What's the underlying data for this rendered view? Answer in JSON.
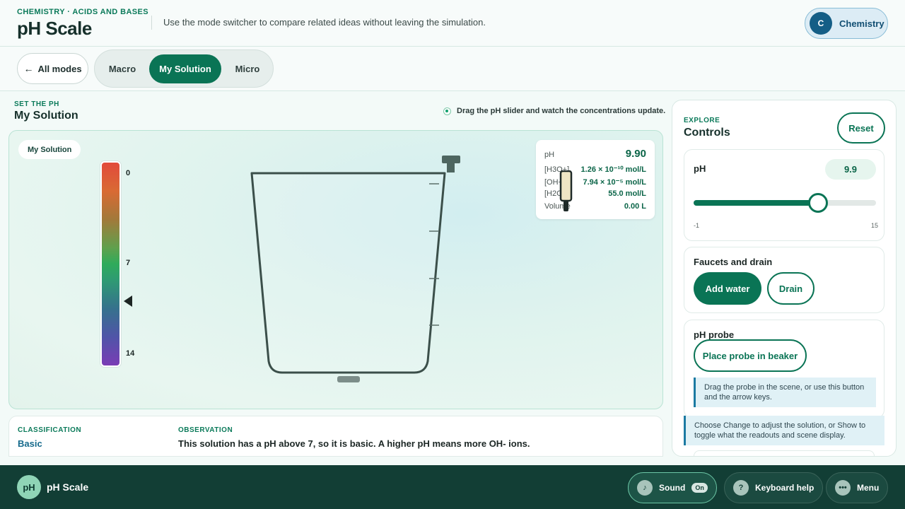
{
  "header": {
    "eyebrow": "CHEMISTRY · ACIDS AND BASES",
    "title": "pH Scale",
    "subtitle": "Use the mode switcher to compare related ideas without leaving the simulation.",
    "subject": {
      "initial": "C",
      "label": "Chemistry"
    }
  },
  "modebar": {
    "back_label": "All modes",
    "tabs": [
      {
        "label": "Macro",
        "active": false
      },
      {
        "label": "My Solution",
        "active": true
      },
      {
        "label": "Micro",
        "active": false
      }
    ]
  },
  "scene": {
    "eyebrow": "SET THE PH",
    "title": "My Solution",
    "hint": "Drag the pH slider and watch the concentrations update.",
    "tag": "My Solution",
    "scale_ticks": [
      "0",
      "7",
      "14"
    ],
    "readout": {
      "ph_label": "pH",
      "ph_value": "9.90",
      "rows": [
        {
          "label": "[H3O+]",
          "value": "1.26 × 10⁻¹⁰ mol/L"
        },
        {
          "label": "[OH−]",
          "value": "7.94 × 10⁻⁵ mol/L"
        },
        {
          "label": "[H2O]",
          "value": "55.0 mol/L"
        },
        {
          "label": "Volume",
          "value": "0.00 L"
        }
      ]
    }
  },
  "classification": {
    "label": "CLASSIFICATION",
    "value": "Basic",
    "observation_label": "OBSERVATION",
    "observation": "This solution has a pH above 7, so it is basic. A higher pH means more OH- ions."
  },
  "controls": {
    "eyebrow": "EXPLORE",
    "title": "Controls",
    "reset_label": "Reset",
    "ph": {
      "label": "pH",
      "value": 9.9,
      "display": "9.9",
      "min": -1,
      "max": 15,
      "min_label": "-1",
      "max_label": "15"
    },
    "faucets": {
      "title": "Faucets and drain",
      "add_label": "Add water",
      "drain_label": "Drain"
    },
    "probe": {
      "title": "pH probe",
      "button_label": "Place probe in beaker",
      "note": "Drag the probe in the scene, or use this button and the arrow keys."
    },
    "tip": "Choose Change to adjust the solution, or Show to toggle what the readouts and scene display."
  },
  "footer": {
    "logo": "pH",
    "title": "pH Scale",
    "sound_label": "Sound",
    "sound_state": "On",
    "keyboard_label": "Keyboard help",
    "menu_label": "Menu"
  },
  "colors": {
    "accent": "#0a7455",
    "footer": "#123e35",
    "info": "#1b7aa2"
  },
  "icons": [
    "back-arrow-icon",
    "music-note-icon",
    "question-icon",
    "menu-dots-icon"
  ]
}
